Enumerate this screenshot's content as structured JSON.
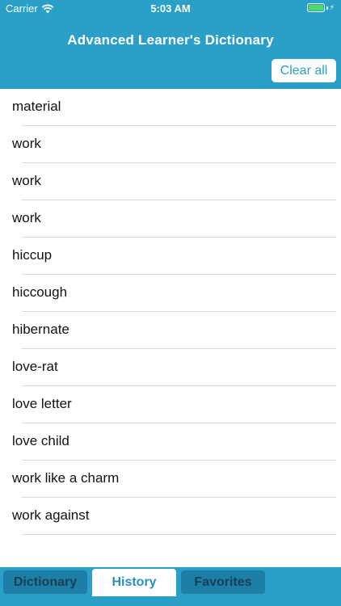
{
  "status_bar": {
    "carrier": "Carrier",
    "time": "5:03 AM"
  },
  "header": {
    "title": "Advanced Learner's Dictionary",
    "clear_all_label": "Clear all"
  },
  "history": {
    "items": [
      "material",
      "work",
      "work",
      "work",
      "hiccup",
      "hiccough",
      "hibernate",
      "love-rat",
      "love letter",
      "love child",
      "work like a charm",
      "work against"
    ]
  },
  "tabs": {
    "dictionary": "Dictionary",
    "history": "History",
    "favorites": "Favorites",
    "active": "history"
  },
  "colors": {
    "brand": "#2aa0c8",
    "tab_inactive": "#1d7fa6",
    "battery": "#4cd964"
  }
}
